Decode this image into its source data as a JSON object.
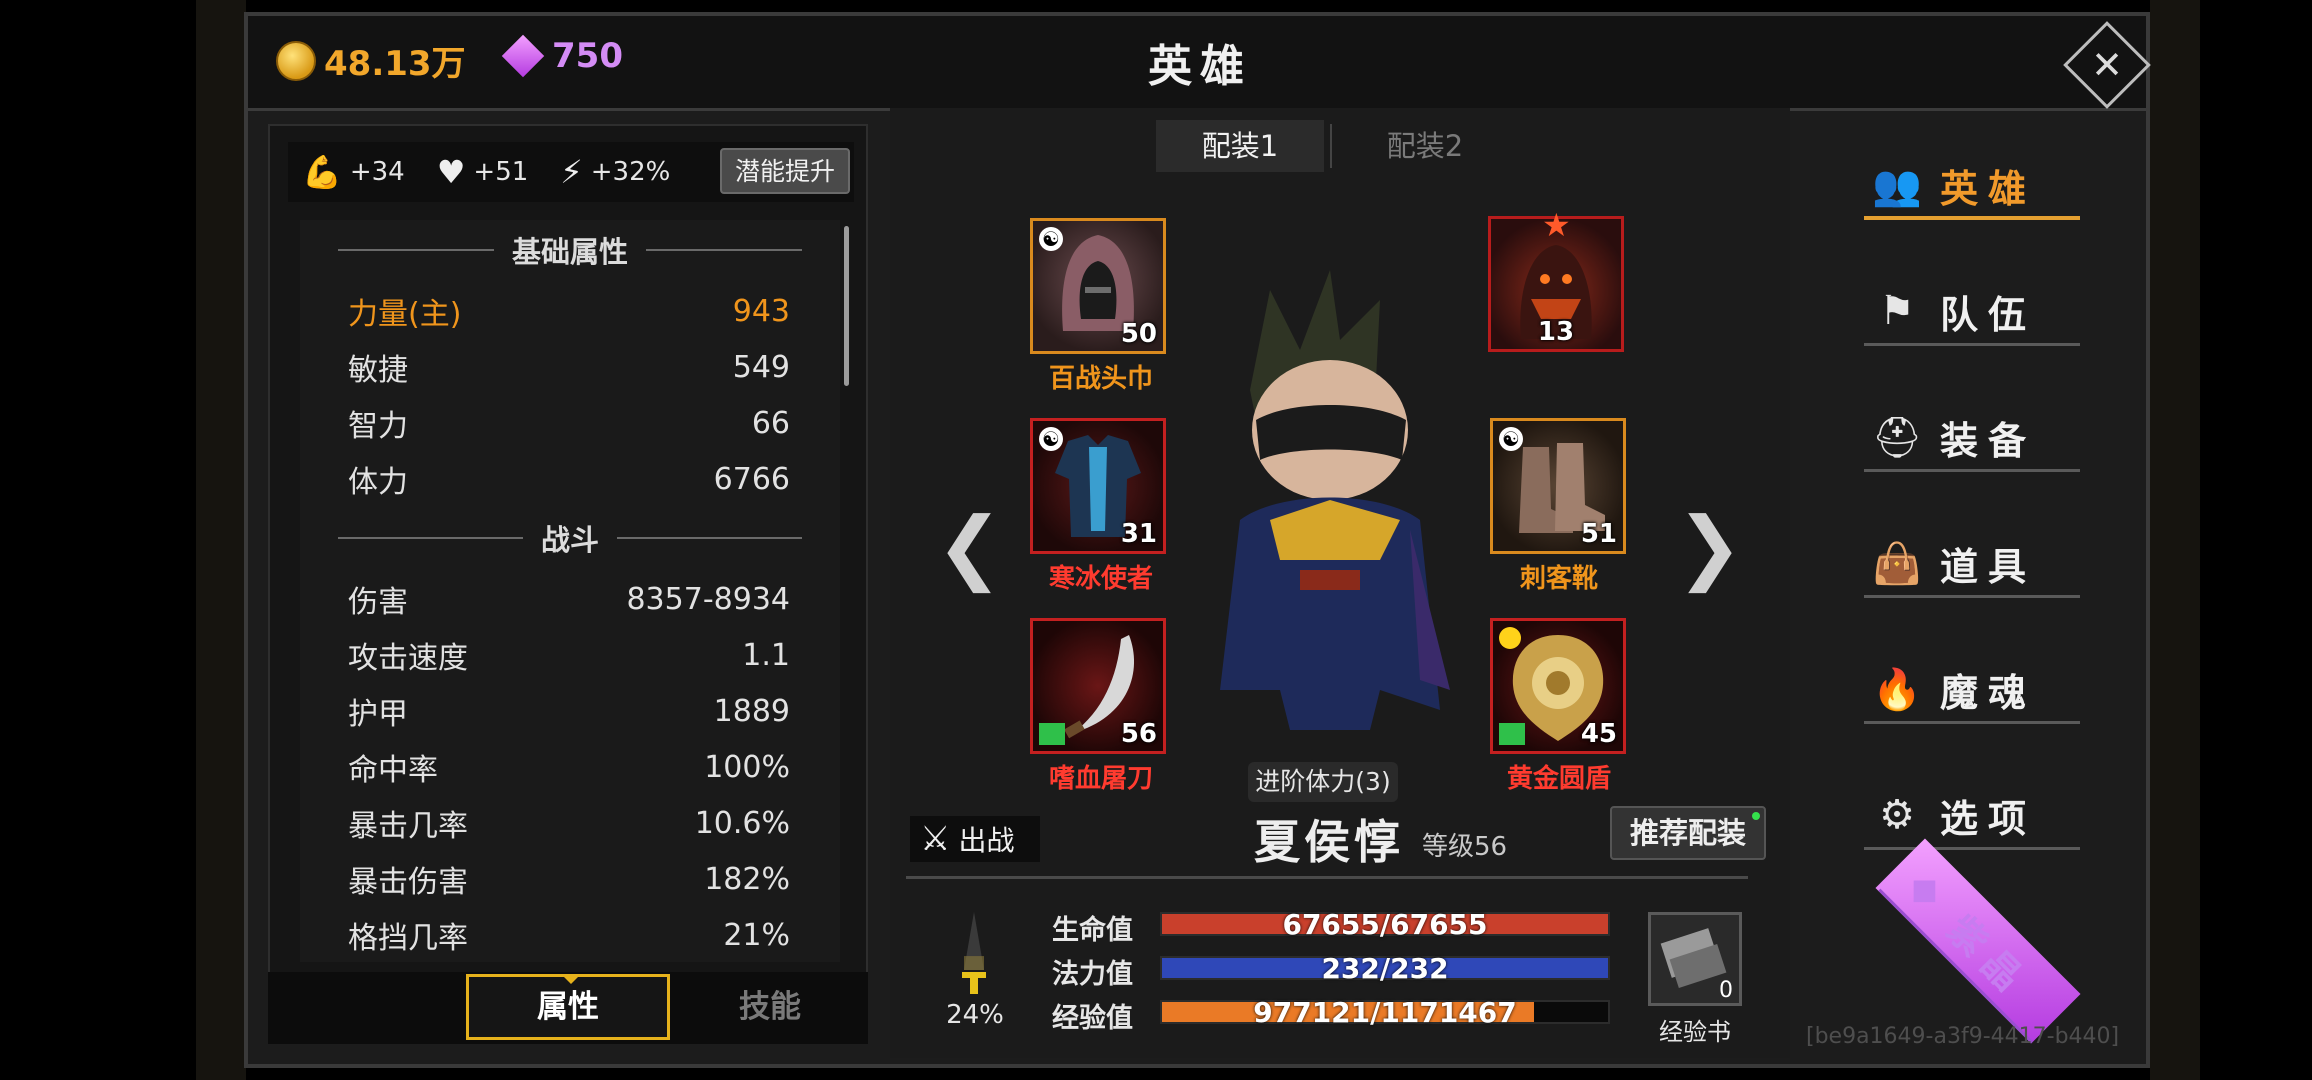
{
  "currency": {
    "gold": "48.13万",
    "gems": "750"
  },
  "header": {
    "title": "英雄"
  },
  "bonuses": {
    "strength": "+34",
    "health": "+51",
    "energy": "+32%",
    "upgrade_label": "潜能提升"
  },
  "stats": {
    "basic_heading": "基础属性",
    "basic": [
      {
        "label": "力量(主)",
        "value": "943"
      },
      {
        "label": "敏捷",
        "value": "549"
      },
      {
        "label": "智力",
        "value": "66"
      },
      {
        "label": "体力",
        "value": "6766"
      }
    ],
    "combat_heading": "战斗",
    "combat": [
      {
        "label": "伤害",
        "value": "8357-8934"
      },
      {
        "label": "攻击速度",
        "value": "1.1"
      },
      {
        "label": "护甲",
        "value": "1889"
      },
      {
        "label": "命中率",
        "value": "100%"
      },
      {
        "label": "暴击几率",
        "value": "10.6%"
      },
      {
        "label": "暴击伤害",
        "value": "182%"
      },
      {
        "label": "格挡几率",
        "value": "21%"
      }
    ]
  },
  "tabs": {
    "attributes": "属性",
    "skills": "技能"
  },
  "loadouts": {
    "first": "配装1",
    "second": "配装2"
  },
  "equipment": {
    "head": {
      "name": "百战头巾",
      "level": "50"
    },
    "companion": {
      "level": "13"
    },
    "armor": {
      "name": "寒冰使者",
      "level": "31"
    },
    "boots": {
      "name": "刺客靴",
      "level": "51"
    },
    "weapon": {
      "name": "嗜血屠刀",
      "level": "56"
    },
    "shield": {
      "name": "黄金圆盾",
      "level": "45"
    }
  },
  "nav": {
    "prev": "❮",
    "next": "❯"
  },
  "hero": {
    "advance_label": "进阶体力(3)",
    "battle_label": "出战",
    "name": "夏侯惇",
    "level": "等级56",
    "recommend_label": "推荐配装",
    "power_pct": "24%",
    "power_fraction": 0.24,
    "hp_label": "生命值",
    "hp": "67655/67655",
    "hp_fraction": 1.0,
    "mp_label": "法力值",
    "mp": "232/232",
    "mp_fraction": 1.0,
    "exp_label": "经验值",
    "exp": "977121/1171467",
    "exp_fraction": 0.834,
    "exp_book_label": "经验书",
    "exp_book_count": "0"
  },
  "menu": [
    {
      "label": "英雄",
      "icon": "hero-icon"
    },
    {
      "label": "队伍",
      "icon": "flag-icon"
    },
    {
      "label": "装备",
      "icon": "helmet-icon"
    },
    {
      "label": "道具",
      "icon": "bag-icon"
    },
    {
      "label": "魔魂",
      "icon": "flame-icon"
    },
    {
      "label": "选项",
      "icon": "gear-icon"
    },
    {
      "label": "紫晶",
      "icon": "gem-icon"
    }
  ],
  "watermark": "[be9a1649-a3f9-4417-b440]",
  "colors": {
    "accent": "#f19a2b",
    "hp": "#c9402c",
    "mp": "#2f48b8",
    "exp": "#ea7a26",
    "epic_name": "#ff3b2f",
    "legend_name": "#f0951c"
  }
}
